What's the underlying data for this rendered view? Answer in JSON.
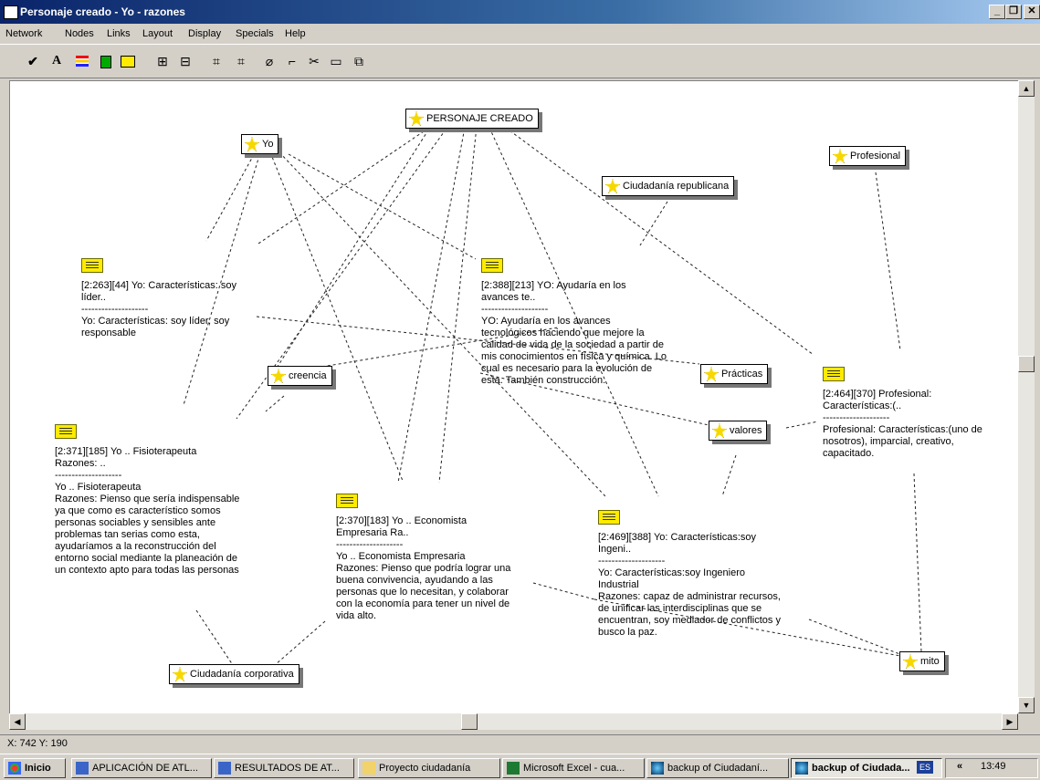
{
  "window": {
    "title": "Personaje creado - Yo - razones"
  },
  "menu": [
    "Network",
    "Nodes",
    "Links",
    "Layout",
    "Display",
    "Specials",
    "Help"
  ],
  "toolbar": {
    "icons": [
      "check-icon",
      "text-font-icon",
      "line-colors-icon",
      "fill-color-icon",
      "box-icon",
      "layout-icon",
      "arrange-icon",
      "network-icon",
      "network2-icon",
      "eraser-icon",
      "connector-icon",
      "cut-icon",
      "box2-icon",
      "copy-icon"
    ],
    "text_glyph": "A"
  },
  "nodes": {
    "personaje": "PERSONAJE CREADO",
    "yo": "Yo",
    "profesional": "Profesional",
    "ciudadania_republicana": "Ciudadanía republicana",
    "creencia": "creencia",
    "practicas": "Prácticas",
    "valores": "valores",
    "ciudadania_corporativa": "Ciudadanía corporativa",
    "mito": "mito"
  },
  "memos": {
    "m263": {
      "title": "[2:263][44] Yo: Características: soy\nlíder..",
      "sep": "--------------------",
      "body": "Yo: Características: soy líder, soy\nresponsable"
    },
    "m388": {
      "title": "[2:388][213] YO: Ayudaría en los\navances te..",
      "sep": "--------------------",
      "body": "YO: Ayudaría en los avances\ntecnológicos haciendo que mejore  la\ncalidad de vida de la sociedad a partir de\nmis conocimientos en física y química.  Lo\ncual es necesario para la evolución de\nesta.  También construcción."
    },
    "m464": {
      "title": "[2:464][370] Profesional:\nCaracterísticas:(..",
      "sep": "--------------------",
      "body": "Profesional: Características:(uno de\nnosotros), imparcial,  creativo,\ncapacitado."
    },
    "m371": {
      "title": "[2:371][185] Yo .. Fisioterapeuta\nRazones: ..",
      "sep": "--------------------",
      "body": "Yo .. Fisioterapeuta\nRazones: Pienso que sería indispensable\nya que como es característico somos\npersonas sociables y sensibles ante\nproblemas tan serias como esta,\nayudaríamos a la reconstrucción del\nentorno social mediante la planeación de\nun contexto apto para todas las personas"
    },
    "m370": {
      "title": "[2:370][183] Yo .. Economista\nEmpresaria Ra..",
      "sep": "--------------------",
      "body": "Yo .. Economista Empresaria\nRazones: Pienso que podría lograr una\nbuena convivencia, ayudando a las\npersonas que lo necesitan, y colaborar\ncon la economía para tener un nivel de\nvida alto."
    },
    "m469": {
      "title": "[2:469][388] Yo: Características:soy\nIngeni..",
      "sep": "--------------------",
      "body": "Yo: Características:soy Ingeniero\nIndustrial\nRazones: capaz de administrar recursos,\nde unificar las interdisciplinas que se\nencuentran, soy mediador de conflictos y\nbusco la paz."
    }
  },
  "status": {
    "coords": "X: 742 Y: 190"
  },
  "taskbar": {
    "start": "Inicio",
    "tasks": [
      "APLICACIÓN DE ATL...",
      "RESULTADOS DE AT...",
      "Proyecto ciudadanía",
      "Microsoft Excel - cua...",
      "backup of Ciudadaní...",
      "backup of Ciudada..."
    ],
    "lang": "ES",
    "chevron": "«",
    "clock": "13:49"
  },
  "colors": {
    "title_start": "#0a246a",
    "title_end": "#a6caf0",
    "node_star": "#f6d800",
    "memo_icon": "#ffeb00"
  }
}
